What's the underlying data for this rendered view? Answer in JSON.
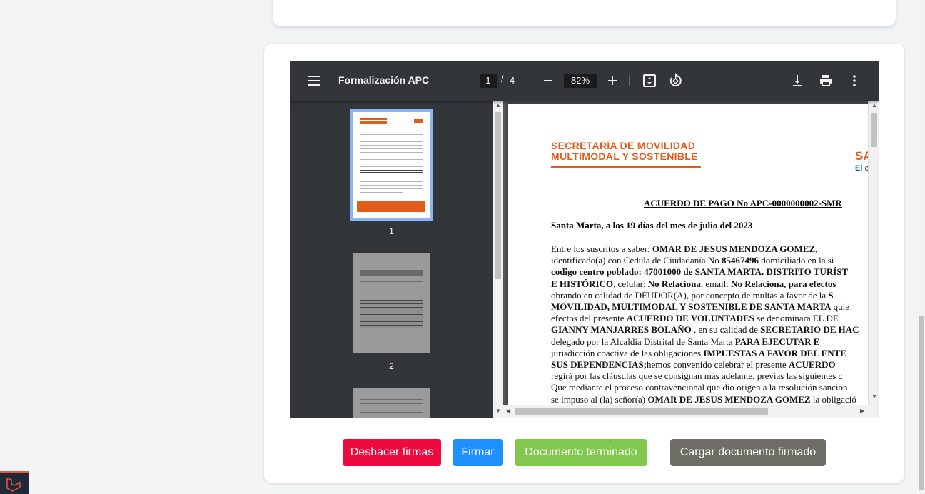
{
  "viewer": {
    "title": "Formalización APC",
    "page_current": "1",
    "page_separator": "/",
    "page_total": "4",
    "zoom": "82%",
    "icons": [
      "menu-icon",
      "zoom-out-icon",
      "zoom-in-icon",
      "fit-page-icon",
      "rotate-icon",
      "download-icon",
      "print-icon",
      "more-vert-icon"
    ]
  },
  "thumbnails": [
    {
      "label": "1",
      "active": true
    },
    {
      "label": "2",
      "active": false
    }
  ],
  "document": {
    "org_line1": "SECRETARÍA DE MOVILIDAD",
    "org_line2": "MULTIMODAL Y SOSTENIBLE",
    "logo_text": "SA",
    "logo_sub": "El c",
    "title": "ACUERDO DE PAGO No APC-0000000002-SMR",
    "date_line": "Santa Marta, a los 19 días del mes de julio del 2023",
    "body_lines": [
      [
        {
          "t": "Entre los suscritos a saber: ",
          "b": false
        },
        {
          "t": "OMAR DE JESUS MENDOZA GOMEZ",
          "b": true
        },
        {
          "t": ",",
          "b": false
        }
      ],
      [
        {
          "t": "identificado(a) con Cedula de Ciudadanía No ",
          "b": false
        },
        {
          "t": "85467496",
          "b": true
        },
        {
          "t": " domiciliado en la si",
          "b": false
        }
      ],
      [
        {
          "t": "codigo centro poblado: 47001000 de SANTA MARTA. DISTRITO TURÍST",
          "b": true
        }
      ],
      [
        {
          "t": "E HISTÓRICO",
          "b": true
        },
        {
          "t": ", celular: ",
          "b": false
        },
        {
          "t": "No Relaciona",
          "b": true
        },
        {
          "t": ", email: ",
          "b": false
        },
        {
          "t": "No Relaciona, para efectos",
          "b": true
        }
      ],
      [
        {
          "t": "obrando en calidad de DEUDOR(A), por concepto de multas a favor de la ",
          "b": false
        },
        {
          "t": "S",
          "b": true
        }
      ],
      [
        {
          "t": "MOVILIDAD, MULTIMODAL Y SOSTENIBLE DE SANTA MARTA",
          "b": true
        },
        {
          "t": " quie",
          "b": false
        }
      ],
      [
        {
          "t": "efectos del presente ",
          "b": false
        },
        {
          "t": "ACUERDO DE VOLUNTADES",
          "b": true
        },
        {
          "t": " se denominara EL DE",
          "b": false
        }
      ],
      [
        {
          "t": "GIANNY MANJARRES BOLAÑO",
          "b": true
        },
        {
          "t": " , en su calidad de ",
          "b": false
        },
        {
          "t": "SECRETARIO DE HAC",
          "b": true
        }
      ],
      [
        {
          "t": "delegado por la Alcaldía Distrital de Santa Marta ",
          "b": false
        },
        {
          "t": "PARA EJECUTAR E",
          "b": true
        }
      ],
      [
        {
          "t": "jurisdicción coactiva de las obligaciones ",
          "b": false
        },
        {
          "t": "IMPUESTAS A FAVOR DEL ENTE",
          "b": true
        }
      ],
      [
        {
          "t": "SUS DEPENDENCIAS;",
          "b": true
        },
        {
          "t": "hemos convenido celebrar el presente ",
          "b": false
        },
        {
          "t": "ACUERDO",
          "b": true
        }
      ],
      [
        {
          "t": "regirá por las cláusulas que se consignan más adelante, previas las siguientes c",
          "b": false
        }
      ],
      [
        {
          "t": "Que mediante el proceso contravencional que dio origen a la resolución sancion",
          "b": false
        }
      ],
      [
        {
          "t": "se impuso al (la) señor(a) ",
          "b": false
        },
        {
          "t": "OMAR DE JESUS MENDOZA GOMEZ",
          "b": true
        },
        {
          "t": " la obligació",
          "b": false
        }
      ]
    ]
  },
  "actions": {
    "undo_signatures": "Deshacer firmas",
    "sign": "Firmar",
    "document_finished": "Documento terminado",
    "upload_signed": "Cargar documento firmado"
  },
  "colors": {
    "undo": "#ed0a3f",
    "sign": "#1e90ff",
    "finished": "#82c84e",
    "upload": "#6e6e66",
    "accent_orange": "#e35b1b"
  }
}
